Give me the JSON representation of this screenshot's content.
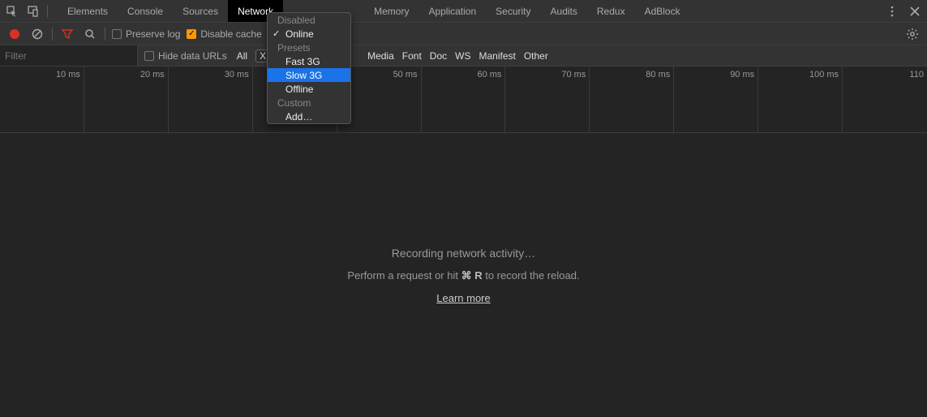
{
  "topbar": {
    "tabs": [
      "Elements",
      "Console",
      "Sources",
      "Network",
      "Memory",
      "Application",
      "Security",
      "Audits",
      "Redux",
      "AdBlock"
    ],
    "active_index": 3
  },
  "toolbar": {
    "preserve_log": "Preserve log",
    "disable_cache": "Disable cache"
  },
  "throttle_menu": {
    "header1": "Disabled",
    "items1": [
      "Online"
    ],
    "header2": "Presets",
    "items2": [
      "Fast 3G",
      "Slow 3G",
      "Offline"
    ],
    "header3": "Custom",
    "items3": [
      "Add…"
    ],
    "checked": "Online",
    "selected": "Slow 3G"
  },
  "filterbar": {
    "placeholder": "Filter",
    "hide_data_urls": "Hide data URLs",
    "types": [
      "All",
      "X",
      "Media",
      "Font",
      "Doc",
      "WS",
      "Manifest",
      "Other"
    ]
  },
  "timeline": {
    "ticks": [
      "10 ms",
      "20 ms",
      "30 ms",
      "",
      "50 ms",
      "60 ms",
      "70 ms",
      "80 ms",
      "90 ms",
      "100 ms",
      "110"
    ]
  },
  "content": {
    "title": "Recording network activity…",
    "hint_pre": "Perform a request or hit ",
    "hint_key": "⌘ R",
    "hint_post": " to record the reload.",
    "learn": "Learn more"
  }
}
